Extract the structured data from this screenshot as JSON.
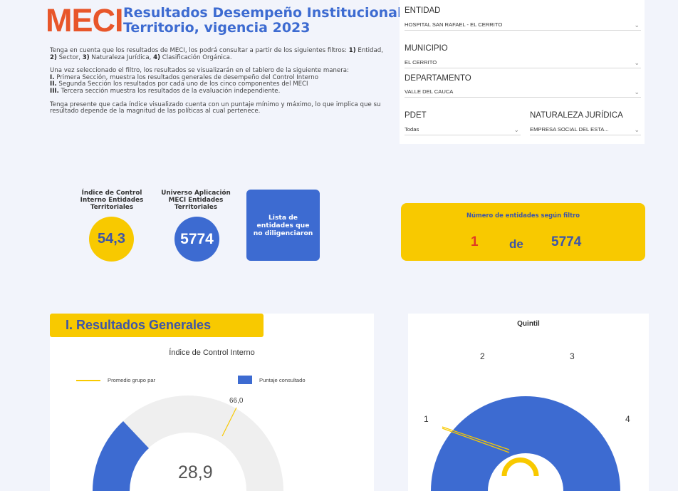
{
  "header": {
    "logo": "MECI",
    "title_line1": "Resultados Desempeño Institucional",
    "title_line2": "Territorio, vigencia 2023"
  },
  "intro": {
    "p1_pre": "Tenga en cuenta que los resultados de MECI, los podrá consultar a partir de los siguientes filtros: ",
    "p1_f1": "1)",
    "p1_t1": " Entidad, ",
    "p1_f2": "2)",
    "p1_t2": " Sector, ",
    "p1_f3": "3)",
    "p1_t3": " Naturaleza Jurídica, ",
    "p1_f4": "4)",
    "p1_t4": " Clasificación Orgánica.",
    "p2": "Una vez seleccionado el filtro, los resultados se visualizarán en el tablero de la siguiente manera:",
    "s1_num": "I.",
    "s1": " Primera Sección, muestra los resultados generales de desempeño del Control Interno",
    "s2_num": "II.",
    "s2": " Segunda Sección los resultados por cada uno de los cinco componentes del MECI",
    "s3_num": "III.",
    "s3": " Tercera sección muestra los resultados de la evaluación independiente.",
    "p3": "Tenga presente que cada índice visualizado cuenta con un puntaje mínimo y máximo, lo que implica que su resultado depende de la magnitud de las políticas al cual pertenece."
  },
  "filters": {
    "entidad_label": "ENTIDAD",
    "entidad_value": "HOSPITAL  SAN RAFAEL  - EL CERRITO",
    "municipio_label": "MUNICIPIO",
    "municipio_value": "EL CERRITO",
    "departamento_label": "DEPARTAMENTO",
    "departamento_value": "VALLE DEL CAUCA",
    "pdet_label": "PDET",
    "pdet_value": "Todas",
    "naturaleza_label": "NATURALEZA JURÍDICA",
    "naturaleza_value": "EMPRESA SOCIAL DEL ESTA..."
  },
  "kpis": {
    "indice_label": "Índice de Control Interno Entidades Territoriales",
    "indice_value": "54,3",
    "universo_label": "Universo Aplicación MECI Entidades Territoriales",
    "universo_value": "5774",
    "lista_button": "Lista de entidades que no diligenciaron"
  },
  "count_box": {
    "title": "Número de entidades según filtro",
    "selected": "1",
    "sep": "de",
    "total": "5774"
  },
  "section": {
    "title": "I. Resultados Generales"
  },
  "gauge": {
    "title": "Índice de Control Interno",
    "legend_avg": "Promedio grupo par",
    "legend_score": "Puntaje consultado",
    "avg_value": "66,0",
    "score_value": "28,9"
  },
  "quintil": {
    "title": "Quintil",
    "labels": [
      "1",
      "2",
      "3",
      "4"
    ]
  },
  "colors": {
    "blue": "#3d6bd1",
    "yellow": "#f8c900",
    "orange": "#e8562a",
    "red": "#e03b24"
  }
}
